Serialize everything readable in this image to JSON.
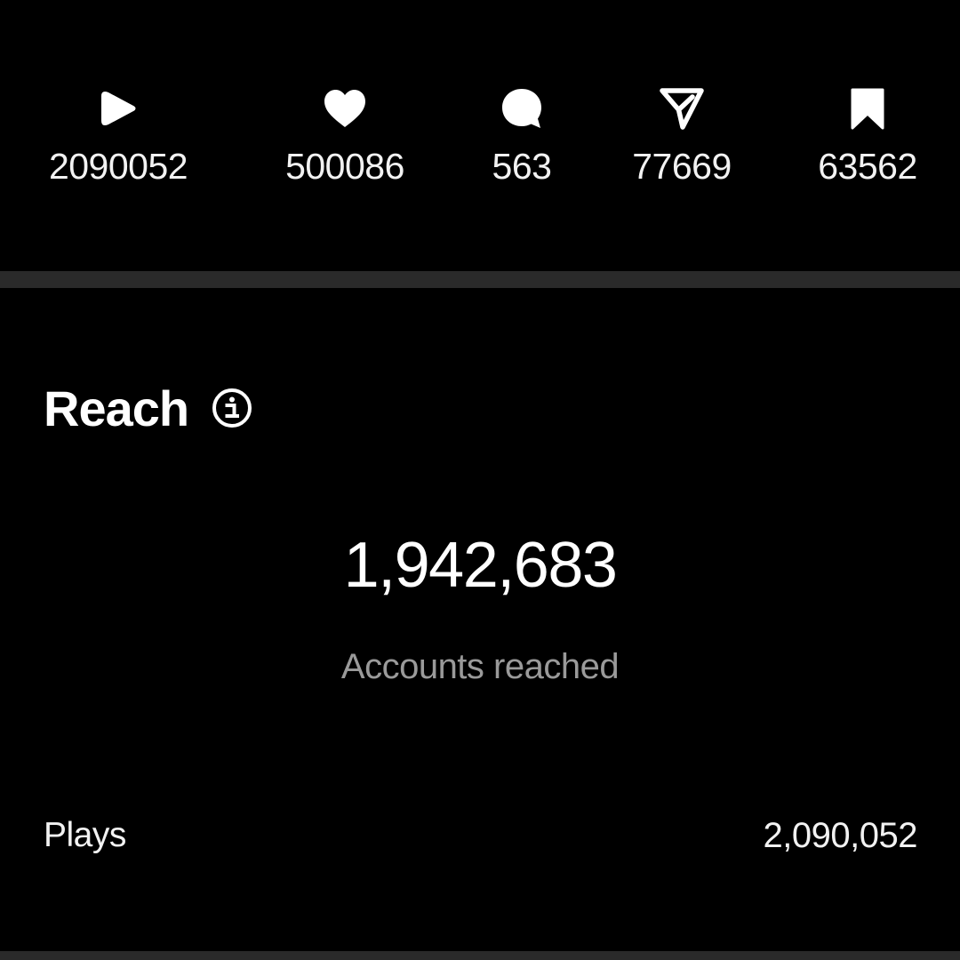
{
  "metrics": [
    {
      "icon": "play-icon",
      "count": "2090052"
    },
    {
      "icon": "heart-icon",
      "count": "500086"
    },
    {
      "icon": "comment-icon",
      "count": "563"
    },
    {
      "icon": "send-icon",
      "count": "77669"
    },
    {
      "icon": "bookmark-icon",
      "count": "63562"
    }
  ],
  "reach": {
    "title": "Reach",
    "info_icon": "info-icon",
    "accounts_reached_value": "1,942,683",
    "accounts_reached_label": "Accounts reached",
    "plays_label": "Plays",
    "plays_value": "2,090,052"
  },
  "colors": {
    "background": "#000000",
    "text": "#ffffff",
    "secondary_text": "#9a9a9a",
    "divider": "#2a2a2a"
  }
}
